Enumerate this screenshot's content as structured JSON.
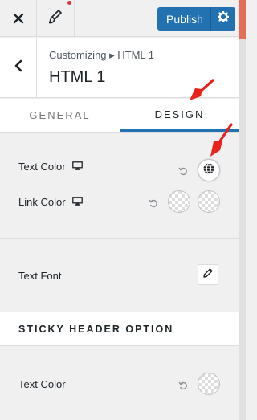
{
  "topbar": {
    "close_icon": "close-icon",
    "brush_icon": "paintbrush-icon",
    "publish_label": "Publish",
    "settings_icon": "gear-icon",
    "accent_color": "#2271b1"
  },
  "header": {
    "breadcrumb": "Customizing ▸ HTML 1",
    "title": "HTML 1",
    "back_icon": "chevron-left-icon"
  },
  "tabs": [
    {
      "label": "GENERAL",
      "active": false
    },
    {
      "label": "DESIGN",
      "active": true
    }
  ],
  "general_section": {
    "text_color_label": "Text Color",
    "link_color_label": "Link Color",
    "device_icon": "desktop-icon",
    "reset_icon": "undo-icon",
    "global_color_icon": "globe-icon"
  },
  "font_section": {
    "text_font_label": "Text Font",
    "edit_icon": "pencil-icon"
  },
  "sticky_section": {
    "heading": "STICKY HEADER OPTION",
    "text_color_label": "Text Color"
  },
  "annotations": {
    "arrow_color": "#e8211a"
  }
}
